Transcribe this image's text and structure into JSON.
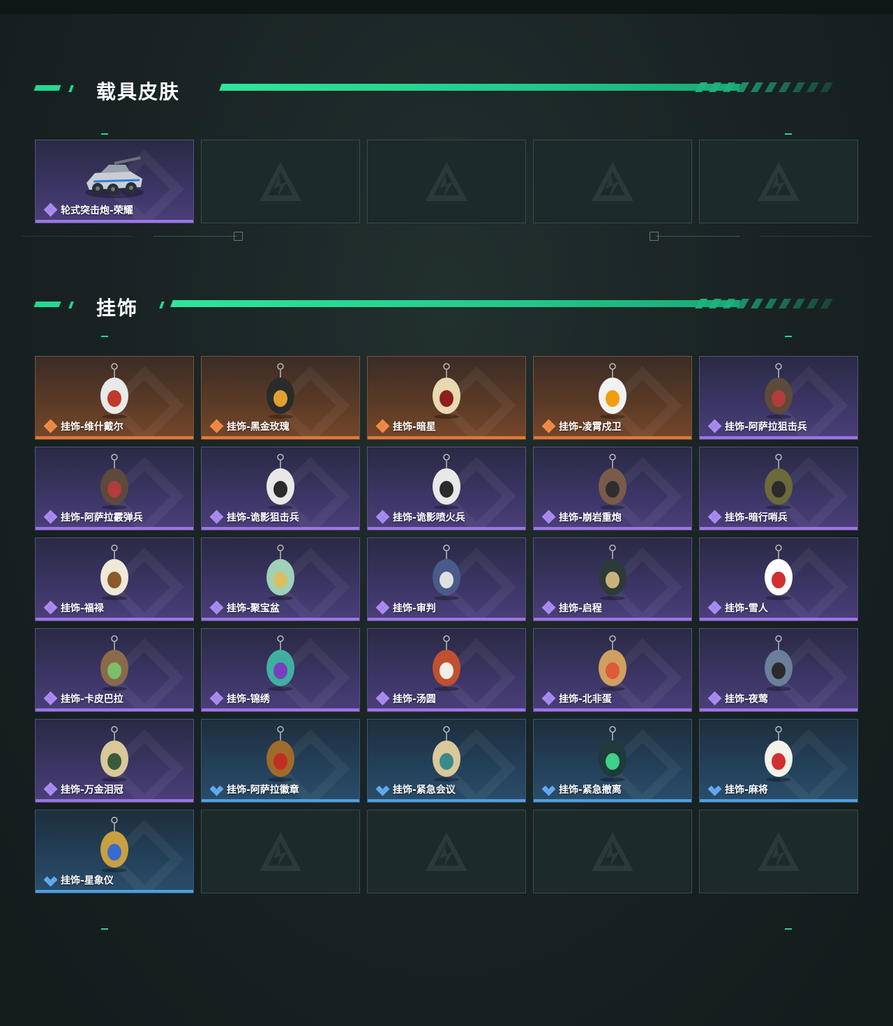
{
  "sections": [
    {
      "title": "载具皮肤"
    },
    {
      "title": "挂饰"
    }
  ],
  "vehicle_skins": [
    {
      "label": "轮式突击炮-荣耀",
      "rarity": "purple",
      "icon": "armored-vehicle-icon"
    },
    {
      "label": "",
      "rarity": "empty"
    },
    {
      "label": "",
      "rarity": "empty"
    },
    {
      "label": "",
      "rarity": "empty"
    },
    {
      "label": "",
      "rarity": "empty"
    }
  ],
  "charms": [
    {
      "label": "挂饰-维什戴尔",
      "rarity": "orange",
      "icon": "card-charm-icon"
    },
    {
      "label": "挂饰-黑金玫瑰",
      "rarity": "orange",
      "icon": "dark-orb-charm-icon"
    },
    {
      "label": "挂饰-暗星",
      "rarity": "orange",
      "icon": "feather-charm-icon"
    },
    {
      "label": "挂饰-凌霄戍卫",
      "rarity": "orange",
      "icon": "chick-charm-icon"
    },
    {
      "label": "挂饰-阿萨拉狙击兵",
      "rarity": "purple",
      "icon": "soldier-charm-icon"
    },
    {
      "label": "挂饰-阿萨拉霰弹兵",
      "rarity": "purple",
      "icon": "soldier-charm-icon"
    },
    {
      "label": "挂饰-诡影狙击兵",
      "rarity": "purple",
      "icon": "masked-soldier-charm-icon"
    },
    {
      "label": "挂饰-诡影喷火兵",
      "rarity": "purple",
      "icon": "masked-soldier-charm-icon"
    },
    {
      "label": "挂饰-崩岩重炮",
      "rarity": "purple",
      "icon": "heavy-soldier-charm-icon"
    },
    {
      "label": "挂饰-暗行哨兵",
      "rarity": "purple",
      "icon": "scout-charm-icon"
    },
    {
      "label": "挂饰-福禄",
      "rarity": "purple",
      "icon": "gourd-charm-icon"
    },
    {
      "label": "挂饰-聚宝盆",
      "rarity": "purple",
      "icon": "treasure-bowl-charm-icon"
    },
    {
      "label": "挂饰-审判",
      "rarity": "purple",
      "icon": "judgement-card-charm-icon"
    },
    {
      "label": "挂饰-启程",
      "rarity": "purple",
      "icon": "ring-medal-charm-icon"
    },
    {
      "label": "挂饰-雪人",
      "rarity": "purple",
      "icon": "snowman-charm-icon"
    },
    {
      "label": "挂饰-卡皮巴拉",
      "rarity": "purple",
      "icon": "capybara-charm-icon"
    },
    {
      "label": "挂饰-锦绣",
      "rarity": "purple",
      "icon": "butterfly-charm-icon"
    },
    {
      "label": "挂饰-汤圆",
      "rarity": "purple",
      "icon": "bowl-charm-icon"
    },
    {
      "label": "挂饰-北非蛋",
      "rarity": "purple",
      "icon": "pan-charm-icon"
    },
    {
      "label": "挂饰-夜莺",
      "rarity": "purple",
      "icon": "bird-charm-icon"
    },
    {
      "label": "挂饰-万金泪冠",
      "rarity": "purple",
      "icon": "crown-charm-icon"
    },
    {
      "label": "挂饰-阿萨拉徽章",
      "rarity": "blue",
      "icon": "badge-charm-icon"
    },
    {
      "label": "挂饰-紧急会议",
      "rarity": "blue",
      "icon": "meeting-charm-icon"
    },
    {
      "label": "挂饰-紧急撤离",
      "rarity": "blue",
      "icon": "exit-sign-charm-icon"
    },
    {
      "label": "挂饰-麻将",
      "rarity": "blue",
      "icon": "mahjong-charm-icon"
    },
    {
      "label": "挂饰-星象仪",
      "rarity": "blue",
      "icon": "astrolabe-charm-icon"
    },
    {
      "label": "",
      "rarity": "empty"
    },
    {
      "label": "",
      "rarity": "empty"
    },
    {
      "label": "",
      "rarity": "empty"
    },
    {
      "label": "",
      "rarity": "empty"
    }
  ]
}
